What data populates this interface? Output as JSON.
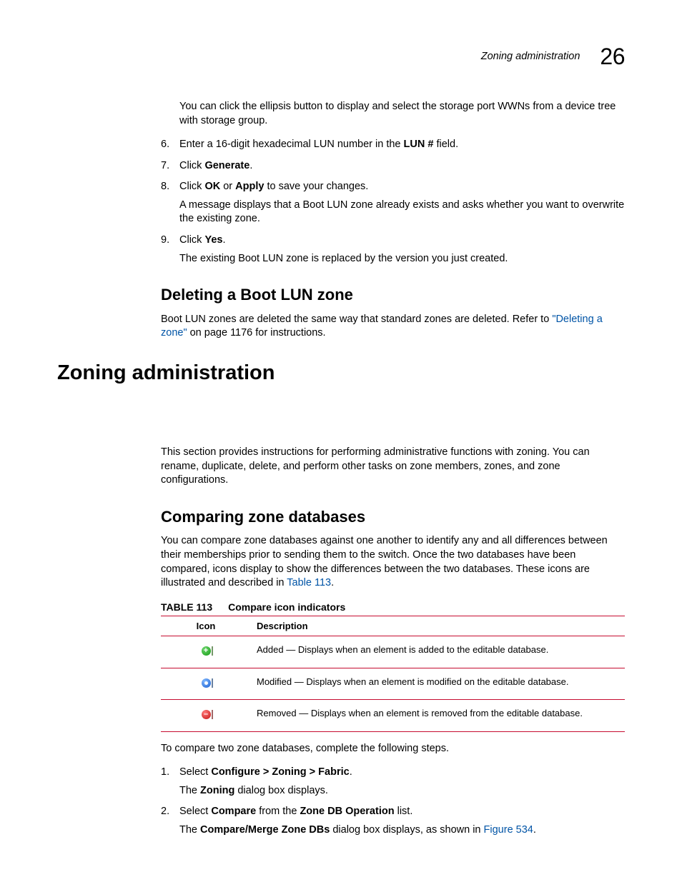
{
  "runningHead": {
    "label": "Zoning administration",
    "number": "26"
  },
  "intro": {
    "p1": "You can click the ellipsis button to display and select the storage port WWNs from a device tree with storage group."
  },
  "steps_a": {
    "s6": {
      "n": "6.",
      "pre": "Enter a 16-digit hexadecimal LUN number in the ",
      "b": "LUN #",
      "post": " field."
    },
    "s7": {
      "n": "7.",
      "pre": "Click ",
      "b": "Generate",
      "post": "."
    },
    "s8": {
      "n": "8.",
      "pre": "Click ",
      "b1": "OK",
      "mid": " or ",
      "b2": "Apply",
      "post": " to save your changes.",
      "sub": "A message displays that a Boot LUN zone already exists and asks whether you want to overwrite the existing zone."
    },
    "s9": {
      "n": "9.",
      "pre": "Click ",
      "b": "Yes",
      "post": ".",
      "sub": "The existing Boot LUN zone is replaced by the version you just created."
    }
  },
  "h_deleting": "Deleting a Boot LUN zone",
  "deleting_p": {
    "pre": "Boot LUN zones are deleted the same way that standard zones are deleted. Refer to ",
    "link": "\"Deleting a zone\"",
    "post": " on page 1176 for instructions."
  },
  "h_admin": "Zoning administration",
  "admin_p": "This section provides instructions for performing administrative functions with zoning. You can rename, duplicate, delete, and perform other tasks on zone members, zones, and zone configurations.",
  "h_compare": "Comparing zone databases",
  "compare_p": {
    "pre": "You can compare zone databases against one another to identify any and all differences between their memberships prior to sending them to the switch. Once the two databases have been compared, icons display to show the differences between the two databases. These icons are illustrated and described in ",
    "link": "Table 113",
    "post": "."
  },
  "table": {
    "label": "TABLE 113",
    "title": "Compare icon indicators",
    "headers": {
      "icon": "Icon",
      "desc": "Description"
    },
    "rows": [
      {
        "icon": "added-icon",
        "desc": "Added — Displays when an element is added to the editable database."
      },
      {
        "icon": "modified-icon",
        "desc": "Modified — Displays when an element is modified on the editable database."
      },
      {
        "icon": "removed-icon",
        "desc": "Removed — Displays when an element is removed from the editable database."
      }
    ]
  },
  "compare_intro": "To compare two zone databases, complete the following steps.",
  "steps_b": {
    "s1": {
      "n": "1.",
      "pre": "Select ",
      "b": "Configure > Zoning > Fabric",
      "post": ".",
      "sub_pre": "The ",
      "sub_b": "Zoning",
      "sub_post": " dialog box displays."
    },
    "s2": {
      "n": "2.",
      "pre": "Select ",
      "b1": "Compare",
      "mid": " from the ",
      "b2": "Zone DB Operation",
      "post": " list.",
      "sub_pre": "The ",
      "sub_b": "Compare/Merge Zone DBs",
      "sub_mid": " dialog box displays, as shown in ",
      "sub_link": "Figure 534",
      "sub_post": "."
    }
  }
}
